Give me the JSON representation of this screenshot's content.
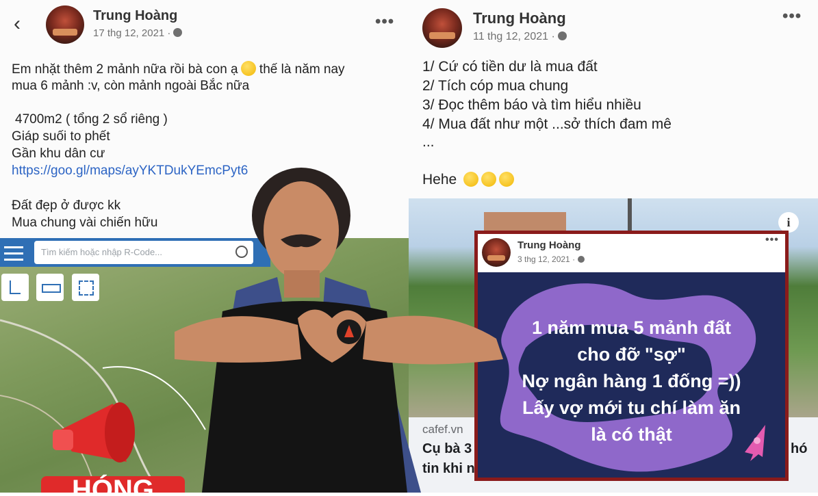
{
  "left_post": {
    "author": "Trung Hoàng",
    "date": "17 thg 12, 2021 ·",
    "lines": [
      "Em nhặt thêm 2 mảnh nữa rồi bà con ạ",
      "thế là năm nay",
      "mua 6 mảnh :v, còn mảnh ngoài Bắc nữa",
      "4700m2 ( tổng 2 sổ riêng )",
      "Giáp suối to phết",
      "Gần khu dân cư",
      "https://goo.gl/maps/ayYKTDukYEmcPyt6",
      "Đất đẹp ở được kk",
      "Mua chung vài chiến hữu"
    ]
  },
  "map_toolbar": {
    "search_placeholder": "Tìm kiếm hoặc nhập R-Code..."
  },
  "banner": {
    "text": "HÓNG"
  },
  "right_post": {
    "author": "Trung Hoàng",
    "date": "11 thg 12, 2021 ·",
    "lines": [
      "1/ Cứ có tiền dư là mua đất",
      "2/ Tích cóp mua chung",
      "3/ Đọc thêm báo và tìm hiểu nhiều",
      "4/ Mua đất như một ...sở thích đam mê",
      "...",
      "Hehe"
    ],
    "link_source": "cafef.vn",
    "link_title_1": "Cụ bà 3",
    "link_title_2": "tin khi n",
    "link_title_end": "hó"
  },
  "inner_post": {
    "author": "Trung Hoàng",
    "date": "3 thg 12, 2021 ·",
    "lines": [
      "1 năm mua 5 mảnh đất",
      "cho đỡ \"sợ\"",
      "Nợ ngân hàng 1 đống =))",
      "Lấy vợ mới tu chí làm ăn",
      "là có thật"
    ]
  },
  "colors": {
    "link": "#2c64c4",
    "inner_bg": "#1f2a5a",
    "blob": "#9b6fd6",
    "frame": "#8a1b1b",
    "megaphone": "#e02a2a"
  }
}
